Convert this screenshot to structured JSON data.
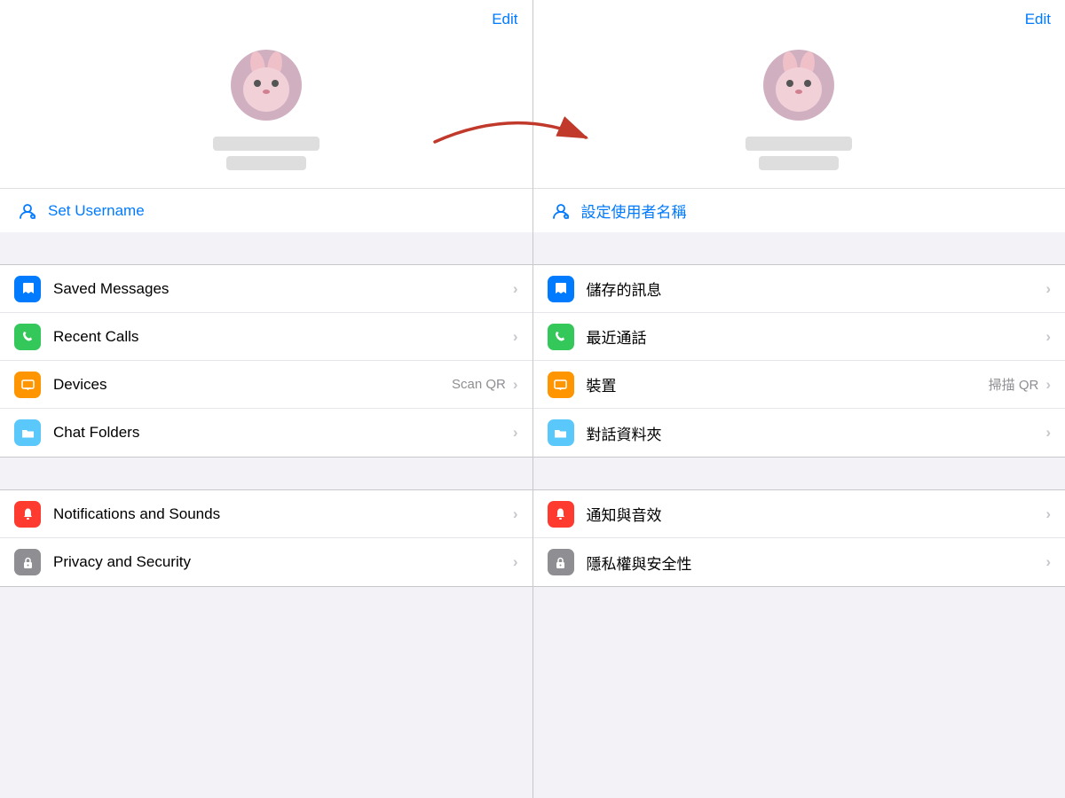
{
  "left": {
    "edit_label": "Edit",
    "set_username_label": "Set Username",
    "menu_items": [
      {
        "id": "saved-messages",
        "icon": "bookmark",
        "icon_class": "icon-blue",
        "label": "Saved Messages",
        "secondary": "",
        "has_chevron": true
      },
      {
        "id": "recent-calls",
        "icon": "phone",
        "icon_class": "icon-green",
        "label": "Recent Calls",
        "secondary": "",
        "has_chevron": true
      },
      {
        "id": "devices",
        "icon": "laptop",
        "icon_class": "icon-orange",
        "label": "Devices",
        "secondary": "Scan QR",
        "has_chevron": true
      },
      {
        "id": "chat-folders",
        "icon": "folder",
        "icon_class": "icon-teal",
        "label": "Chat Folders",
        "secondary": "",
        "has_chevron": true
      }
    ],
    "menu_items2": [
      {
        "id": "notifications",
        "icon": "bell",
        "icon_class": "icon-red",
        "label": "Notifications and Sounds",
        "secondary": "",
        "has_chevron": true
      },
      {
        "id": "privacy",
        "icon": "lock",
        "icon_class": "icon-gray",
        "label": "Privacy and Security",
        "secondary": "",
        "has_chevron": true
      }
    ]
  },
  "right": {
    "edit_label": "Edit",
    "set_username_label": "設定使用者名稱",
    "menu_items": [
      {
        "id": "saved-messages-tw",
        "icon": "bookmark",
        "icon_class": "icon-blue",
        "label": "儲存的訊息",
        "secondary": "",
        "has_chevron": true
      },
      {
        "id": "recent-calls-tw",
        "icon": "phone",
        "icon_class": "icon-green",
        "label": "最近通話",
        "secondary": "",
        "has_chevron": true
      },
      {
        "id": "devices-tw",
        "icon": "laptop",
        "icon_class": "icon-orange",
        "label": "裝置",
        "secondary": "掃描 QR",
        "has_chevron": true
      },
      {
        "id": "chat-folders-tw",
        "icon": "folder",
        "icon_class": "icon-teal",
        "label": "對話資料夾",
        "secondary": "",
        "has_chevron": true
      }
    ],
    "menu_items2": [
      {
        "id": "notifications-tw",
        "icon": "bell",
        "icon_class": "icon-red",
        "label": "通知與音效",
        "secondary": "",
        "has_chevron": true
      },
      {
        "id": "privacy-tw",
        "icon": "lock",
        "icon_class": "icon-gray",
        "label": "隱私權與安全性",
        "secondary": "",
        "has_chevron": true
      }
    ]
  },
  "icons": {
    "bookmark": "🔖",
    "phone": "📞",
    "laptop": "💻",
    "folder": "📁",
    "bell": "🔔",
    "lock": "🔒",
    "username": "👤"
  }
}
